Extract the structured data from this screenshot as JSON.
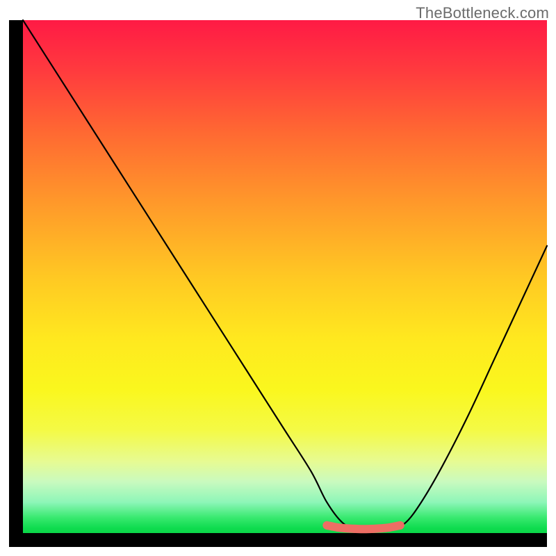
{
  "watermark": "TheBottleneck.com",
  "chart_data": {
    "type": "line",
    "title": "",
    "xlabel": "",
    "ylabel": "",
    "xlim": [
      0,
      100
    ],
    "ylim": [
      0,
      100
    ],
    "grid": false,
    "series": [
      {
        "name": "bottleneck-curve",
        "color": "#000000",
        "x": [
          0,
          5,
          10,
          15,
          20,
          25,
          30,
          35,
          40,
          45,
          50,
          55,
          58,
          61,
          64,
          67,
          70,
          73,
          76,
          80,
          85,
          90,
          95,
          100
        ],
        "values": [
          100,
          92,
          84,
          76,
          68,
          60,
          52,
          44,
          36,
          28,
          20,
          12,
          6,
          2,
          0.5,
          0.3,
          0.5,
          2,
          6,
          13,
          23,
          34,
          45,
          56
        ]
      },
      {
        "name": "optimal-zone",
        "color": "#ee6e64",
        "x": [
          58,
          60,
          62,
          64,
          66,
          68,
          70,
          72
        ],
        "values": [
          1.5,
          1.1,
          0.9,
          0.8,
          0.8,
          0.9,
          1.1,
          1.5
        ]
      }
    ],
    "background_gradient": {
      "stops": [
        {
          "pos": 0,
          "color": "#ff1a45"
        },
        {
          "pos": 10,
          "color": "#ff3b3e"
        },
        {
          "pos": 22,
          "color": "#ff6932"
        },
        {
          "pos": 36,
          "color": "#ff9a2a"
        },
        {
          "pos": 50,
          "color": "#ffc823"
        },
        {
          "pos": 62,
          "color": "#ffe81f"
        },
        {
          "pos": 72,
          "color": "#faf71e"
        },
        {
          "pos": 80,
          "color": "#f4fa46"
        },
        {
          "pos": 86,
          "color": "#e7fb92"
        },
        {
          "pos": 90,
          "color": "#c9fabf"
        },
        {
          "pos": 94,
          "color": "#8df6b8"
        },
        {
          "pos": 97,
          "color": "#38e96f"
        },
        {
          "pos": 99,
          "color": "#0fdc4f"
        },
        {
          "pos": 100,
          "color": "#0bd648"
        }
      ]
    }
  }
}
